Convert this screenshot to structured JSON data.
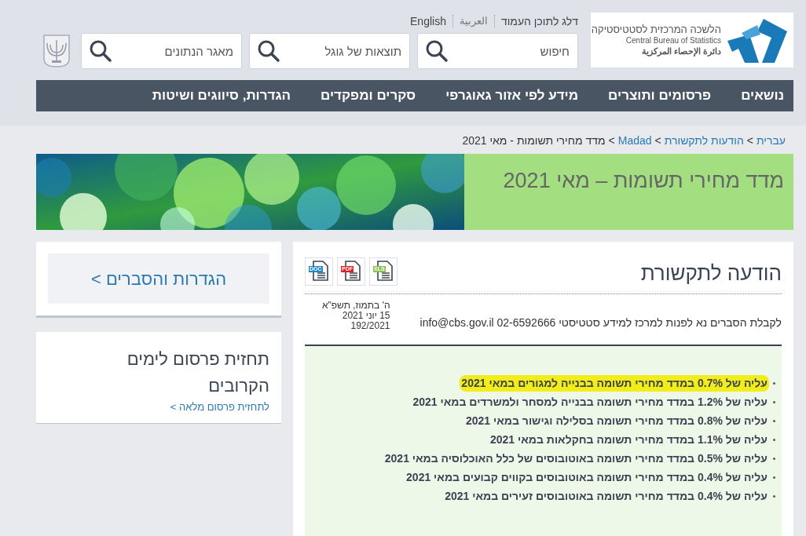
{
  "top_links": [
    "דלג לתוכן העמוד",
    "العربية",
    "English"
  ],
  "logo": {
    "title": "הלשכה המרכזית לסטטיסטיקה",
    "subtitle_en": "Central Bureau of Statistics",
    "subtitle_ar": "دائرة الإحصاء المركزية"
  },
  "search_fields": [
    {
      "placeholder": "חיפוש"
    },
    {
      "placeholder": "תוצאות של גוגל"
    },
    {
      "placeholder": "מאגר הנתונים"
    }
  ],
  "nav": [
    "נושאים",
    "פרסומים ותוצרים",
    "מידע לפי אזור גאוגרפי",
    "סקרים ומפקדים",
    "הגדרות, סיווגים ושיטות"
  ],
  "breadcrumb": [
    {
      "label": "עברית",
      "link": true
    },
    {
      "separator": ">",
      "label": "הודעות לתקשורת",
      "link": true
    },
    {
      "separator": ">",
      "label": "Madad",
      "link": true
    },
    {
      "separator": ">",
      "label": "מדד מחירי תשומות - מאי 2021",
      "link": false
    }
  ],
  "banner": {
    "title": "מדד מחירי תשומות – מאי 2021",
    "kind": "picture"
  },
  "article": {
    "heading": "הודעה לתקשורת",
    "files": [
      {
        "label": "XLS",
        "color": "#8cc152"
      },
      {
        "label": "PDF",
        "color": "#e02020"
      },
      {
        "label": "DOC",
        "color": "#1e88c8"
      }
    ],
    "contact": "לקבלת הסברים נא לפנות למרכז למידע סטטיסטי 02-6592666 info@cbs.gov.il",
    "date_lines": [
      "ה' בתמוז, תשפ\"א",
      "15 יוני 2021",
      "192/2021"
    ],
    "highlights": [
      {
        "text": "עליה של 0.7% במדד מחירי תשומה בבנייה למגורים במאי 2021",
        "highlighted": true
      },
      {
        "text": "עליה של 1.2% במדד מחירי תשומה בבנייה למסחר ולמשרדים במאי 2021",
        "highlighted": false
      },
      {
        "text": "עליה של 0.8% במדד מחירי תשומה בסלילה וגישור במאי 2021",
        "highlighted": false
      },
      {
        "text": "עליה של 1.1% במדד מחירי תשומה בחקלאות במאי 2021",
        "highlighted": false
      },
      {
        "text": "עליה של 0.5% במדד מחירי תשומה באוטובוסים של כלל האוכלוסיה במאי 2021",
        "highlighted": false
      },
      {
        "text": "עליה של 0.4% במדד מחירי תשומה באוטובוסים בקווים קבועים במאי 2021",
        "highlighted": false
      },
      {
        "text": "עליה של 0.4% במדד מחירי תשומה באוטובוסים זעירים במאי 2021",
        "highlighted": false
      }
    ]
  },
  "sidebar": {
    "definitions_button": "הגדרות והסברים >",
    "forecast_title": "תחזית פרסום לימים הקרובים",
    "forecast_link": "לתחזית פרסום מלאה >"
  }
}
